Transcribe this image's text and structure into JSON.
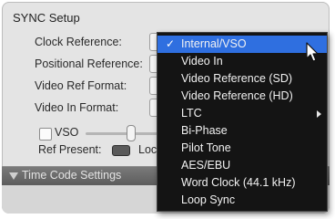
{
  "sync": {
    "title": "SYNC Setup",
    "clock_reference_label": "Clock Reference:",
    "positional_reference_label": "Positional Reference:",
    "video_ref_format_label": "Video Ref Format:",
    "video_in_format_label": "Video In Format:",
    "vso_label": "VSO",
    "ref_present_label": "Ref Present:",
    "lock_label_partial": "Loc"
  },
  "time_code": {
    "title": "Time Code Settings"
  },
  "menu": {
    "items": [
      {
        "label": "Internal/VSO",
        "checked": true,
        "highlighted": true
      },
      {
        "label": "Video In"
      },
      {
        "label": "Video Reference (SD)"
      },
      {
        "label": "Video Reference (HD)"
      },
      {
        "label": "LTC",
        "has_submenu": true
      },
      {
        "label": "Bi-Phase"
      },
      {
        "label": "Pilot Tone"
      },
      {
        "label": "AES/EBU"
      },
      {
        "label": "Word Clock (44.1 kHz)"
      },
      {
        "label": "Loop Sync"
      }
    ],
    "check_glyph": "✓"
  },
  "colors": {
    "highlight": "#2f6fe0",
    "menu_background": "#141414",
    "panel_background": "#e4e4e4"
  }
}
